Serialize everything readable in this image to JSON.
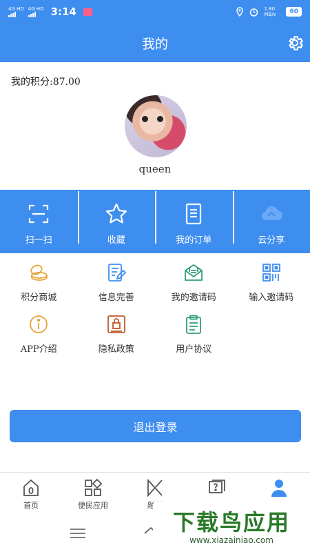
{
  "status": {
    "net1": "4G HD",
    "net2": "4G HD",
    "time": "3:14",
    "speed": "1.80 MB/s",
    "battery": "60"
  },
  "header": {
    "title": "我的"
  },
  "profile": {
    "points_label": "我的积分:87.00",
    "username": "queen"
  },
  "quick_actions": [
    {
      "label": "扫一扫",
      "icon": "scan-icon"
    },
    {
      "label": "收藏",
      "icon": "star-icon"
    },
    {
      "label": "我的订单",
      "icon": "document-icon"
    },
    {
      "label": "云分享",
      "icon": "cloud-icon"
    }
  ],
  "grid": [
    {
      "label": "积分商城",
      "icon": "coins-icon",
      "color": "#e8a23a"
    },
    {
      "label": "信息完善",
      "icon": "edit-document-icon",
      "color": "#3e8ef0"
    },
    {
      "label": "我的邀请码",
      "icon": "mail-icon",
      "color": "#2e9e7a"
    },
    {
      "label": "输入邀请码",
      "icon": "qrcode-icon",
      "color": "#3e8ef0"
    },
    {
      "label": "APP介绍",
      "icon": "info-icon",
      "color": "#e8a23a"
    },
    {
      "label": "隐私政策",
      "icon": "lock-document-icon",
      "color": "#c2572b"
    },
    {
      "label": "用户协议",
      "icon": "clipboard-icon",
      "color": "#2e9e7a"
    }
  ],
  "logout_label": "退出登录",
  "tabs": [
    {
      "label": "首页",
      "icon": "home-tab-icon"
    },
    {
      "label": "便民应用",
      "icon": "apps-icon"
    },
    {
      "label": "融媒",
      "icon": "media-icon"
    },
    {
      "label": "",
      "icon": "help-icon"
    },
    {
      "label": "",
      "icon": "user-icon"
    }
  ],
  "watermark": {
    "title": "下载鸟应用",
    "url": "www.xiazainiao.com"
  },
  "colors": {
    "accent": "#3e8ef0"
  }
}
